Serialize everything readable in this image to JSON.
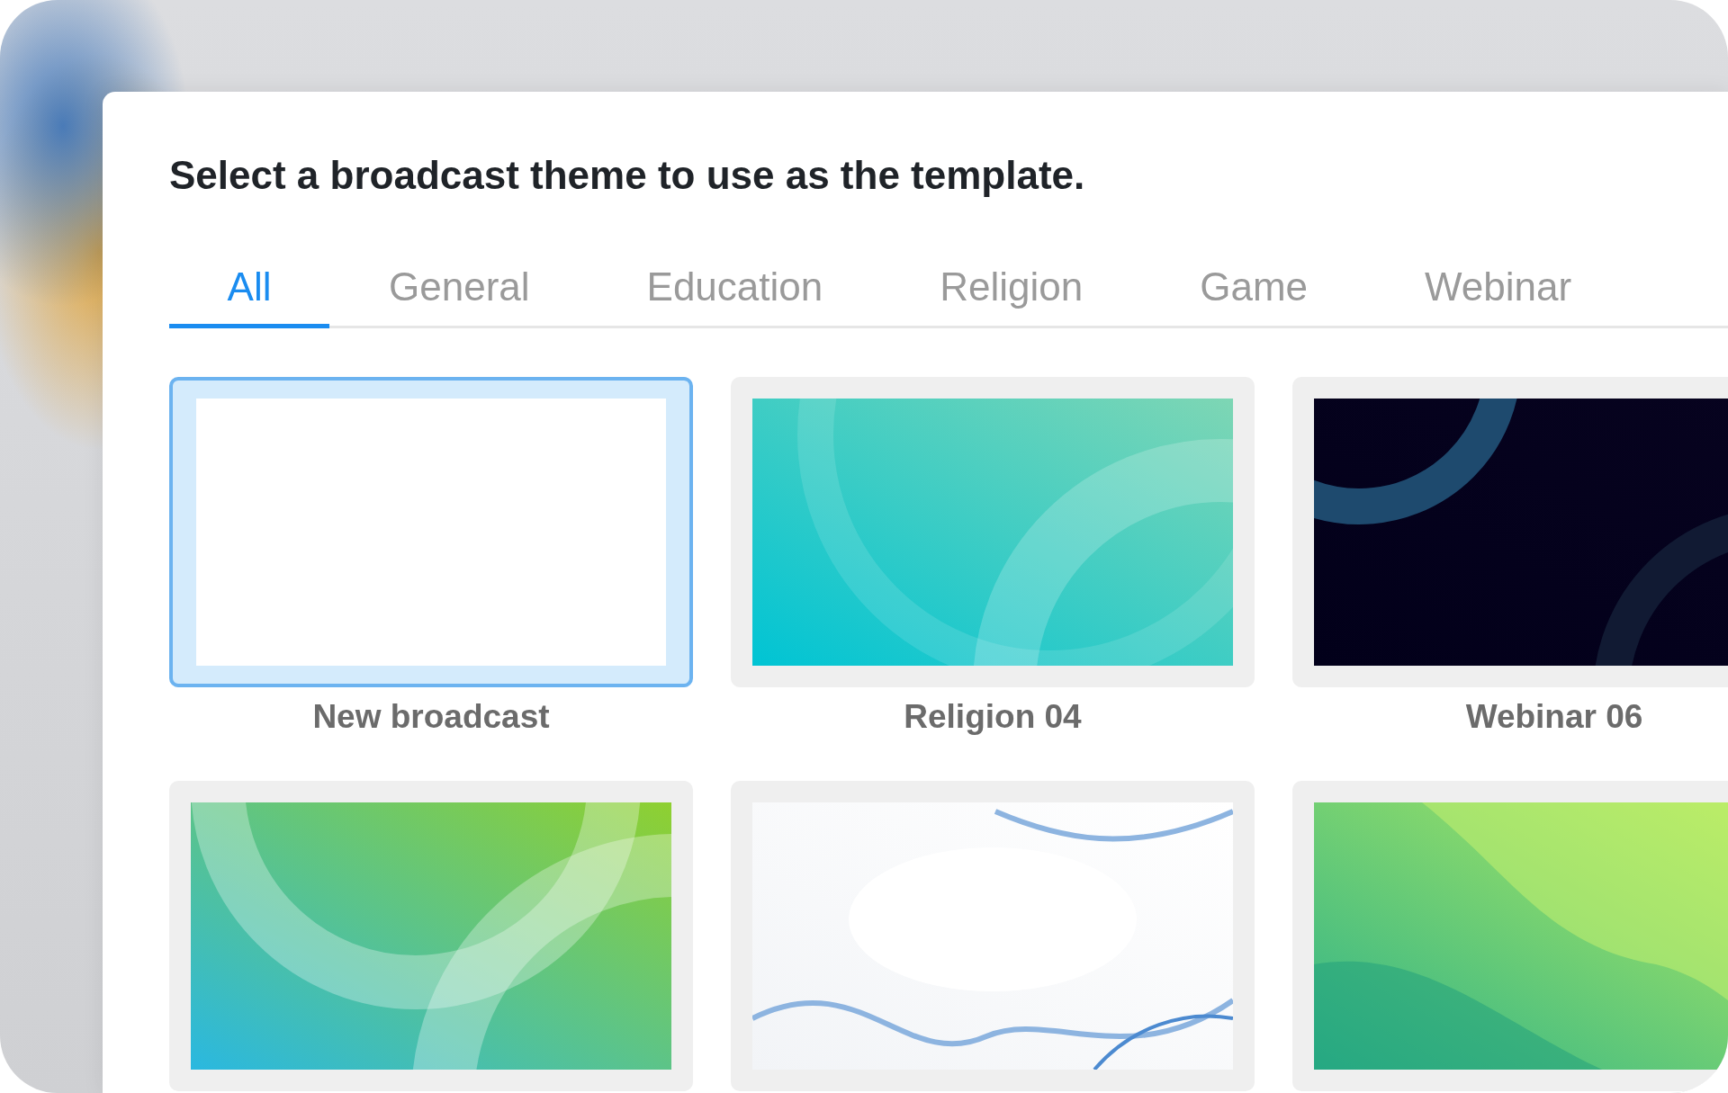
{
  "dialog": {
    "title": "Select a broadcast theme to use as the template."
  },
  "tabs": [
    {
      "label": "All",
      "selected": true
    },
    {
      "label": "General",
      "selected": false
    },
    {
      "label": "Education",
      "selected": false
    },
    {
      "label": "Religion",
      "selected": false
    },
    {
      "label": "Game",
      "selected": false
    },
    {
      "label": "Webinar",
      "selected": false
    }
  ],
  "themes": [
    {
      "label": "New broadcast",
      "kind": "blank",
      "selected": true
    },
    {
      "label": "Religion 04",
      "kind": "picture",
      "selected": false
    },
    {
      "label": "Webinar 06",
      "kind": "picture",
      "selected": false
    },
    {
      "kind": "picture",
      "selected": false
    },
    {
      "kind": "picture",
      "selected": false
    },
    {
      "kind": "picture",
      "selected": false
    }
  ]
}
